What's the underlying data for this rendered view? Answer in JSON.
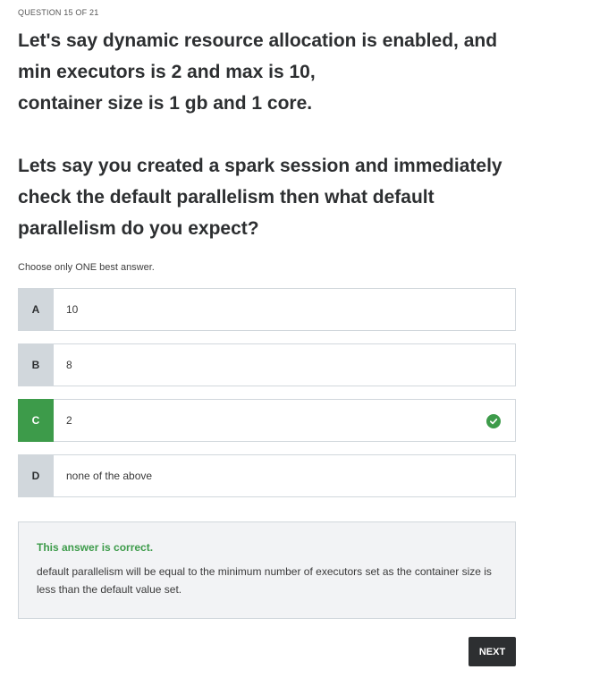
{
  "quiz": {
    "progress": "QUESTION 15 OF 21",
    "question_part1": "Let's say dynamic resource allocation is enabled, and\nmin executors is 2 and max is 10,\ncontainer size is 1 gb and 1 core.",
    "question_part2": "Lets say you created a spark session and immediately\ncheck the default parallelism then what default\nparallelism do you expect?",
    "instruction": "Choose only ONE best answer.",
    "options": [
      {
        "letter": "A",
        "text": "10"
      },
      {
        "letter": "B",
        "text": "8"
      },
      {
        "letter": "C",
        "text": "2",
        "correct": true
      },
      {
        "letter": "D",
        "text": "none of the above"
      }
    ],
    "feedback": {
      "status": "This answer is correct.",
      "explanation": "default parallelism will be equal to the minimum number of executors set as the container size is less than the default value set."
    },
    "next_label": "NEXT"
  },
  "colors": {
    "correct_green": "#3d9b4a",
    "letter_gray": "#d1d7dc",
    "button_dark": "#2d2f31",
    "feedback_bg": "#f2f3f5"
  },
  "icons": {
    "correct_marker": "check-circle-icon"
  }
}
